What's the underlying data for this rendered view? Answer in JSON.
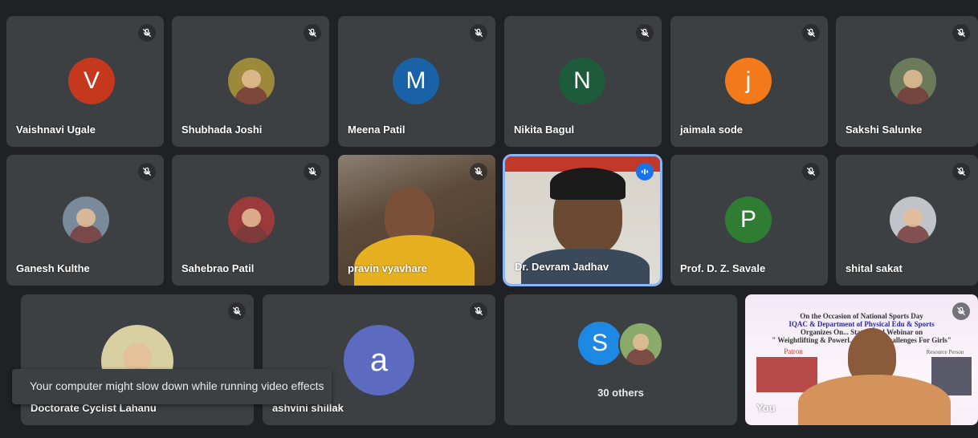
{
  "participants": [
    {
      "name": "Vaishnavi Ugale",
      "avatar_letter": "V",
      "avatar_color": "#c5381e",
      "muted": true
    },
    {
      "name": "Shubhada Joshi",
      "avatar_letter": "",
      "avatar_type": "photo",
      "muted": true
    },
    {
      "name": "Meena Patil",
      "avatar_letter": "M",
      "avatar_color": "#1a62a8",
      "muted": true
    },
    {
      "name": "Nikita Bagul",
      "avatar_letter": "N",
      "avatar_color": "#1e5a3c",
      "muted": true
    },
    {
      "name": "jaimala sode",
      "avatar_letter": "j",
      "avatar_color": "#f37a1b",
      "muted": true
    },
    {
      "name": "Sakshi Salunke",
      "avatar_letter": "",
      "avatar_type": "photo",
      "muted": true
    },
    {
      "name": "Ganesh Kulthe",
      "avatar_letter": "",
      "avatar_type": "photo",
      "muted": true
    },
    {
      "name": "Sahebrao Patil",
      "avatar_letter": "",
      "avatar_type": "photo",
      "muted": true
    },
    {
      "name": "pravin vyavhare",
      "video": true,
      "muted": true
    },
    {
      "name": "Dr. Devram Jadhav",
      "video": true,
      "speaking": true
    },
    {
      "name": "Prof. D. Z. Savale",
      "avatar_letter": "P",
      "avatar_color": "#2e7d32",
      "muted": true
    },
    {
      "name": "shital sakat",
      "avatar_letter": "",
      "avatar_type": "photo",
      "muted": true
    },
    {
      "name": "Doctorate Cyclist Lahanu",
      "avatar_letter": "",
      "avatar_type": "photo",
      "muted": true
    },
    {
      "name": "ashvini shillak",
      "avatar_letter": "a",
      "avatar_color": "#5c6bc0",
      "muted": true
    }
  ],
  "others": {
    "label": "30 others",
    "avatar_letter": "S",
    "avatar_color": "#1e88e5"
  },
  "self_tile": {
    "label": "You",
    "poster_lines": [
      "On the Occasion of National Sports Day",
      "IQAC & Department of Physical Edu & Sports",
      "Organizes On... State Level Webinar on",
      "\" Weightlifting & Powerl... unities : Challenges For Girls\"",
      "Patron",
      "Resource Person"
    ]
  },
  "toast": {
    "text": "Your computer might slow down while running video effects"
  },
  "colors": {
    "background": "#202124",
    "tile": "#3c4043",
    "speaking_border": "#8ab4f8"
  }
}
